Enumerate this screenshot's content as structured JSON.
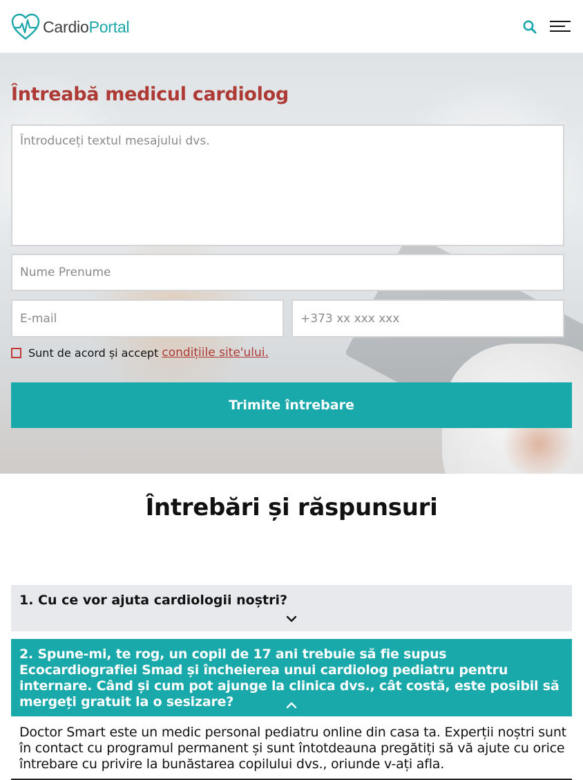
{
  "header": {
    "logo_part1": "Cardio",
    "logo_part2": "Portal",
    "search_icon": "search-icon",
    "menu_icon": "hamburger-menu-icon"
  },
  "form": {
    "title": "Întreabă medicul cardiolog",
    "message_placeholder": "Întroduceți textul mesajului dvs.",
    "name_placeholder": "Nume Prenume",
    "email_placeholder": "E-mail",
    "phone_placeholder": "+373 xx xxx xxx",
    "agree_text": "Sunt de acord și accept",
    "agree_link": "condițiile site'ului.",
    "submit_label": "Trimite întrebare"
  },
  "qa": {
    "title": "Întrebări și răspunsuri",
    "items": [
      {
        "question": "1. Cu ce vor ajuta cardiologii noștri?",
        "expanded": false
      },
      {
        "question": "2. Spune-mi, te rog, un copil de 17 ani trebuie să fie supus Ecocardiografiei Smad și încheierea unui cardiolog pediatru pentru internare. Când și cum pot ajunge la clinica dvs., cât costă, este posibil să mergeți gratuit la o sesizare?",
        "expanded": true,
        "answer": "Doctor Smart este un medic personal pediatru online din casa ta. Experții noștri sunt în contact cu programul permanent și sunt întotdeauna pregătiți să vă ajute cu orice întrebare cu privire la bunăstarea copilului dvs., oriunde v-ați afla."
      }
    ]
  },
  "colors": {
    "accent": "#1aa9ab",
    "title_red": "#ad3a35",
    "accordion_grey": "#e7e9ec"
  }
}
